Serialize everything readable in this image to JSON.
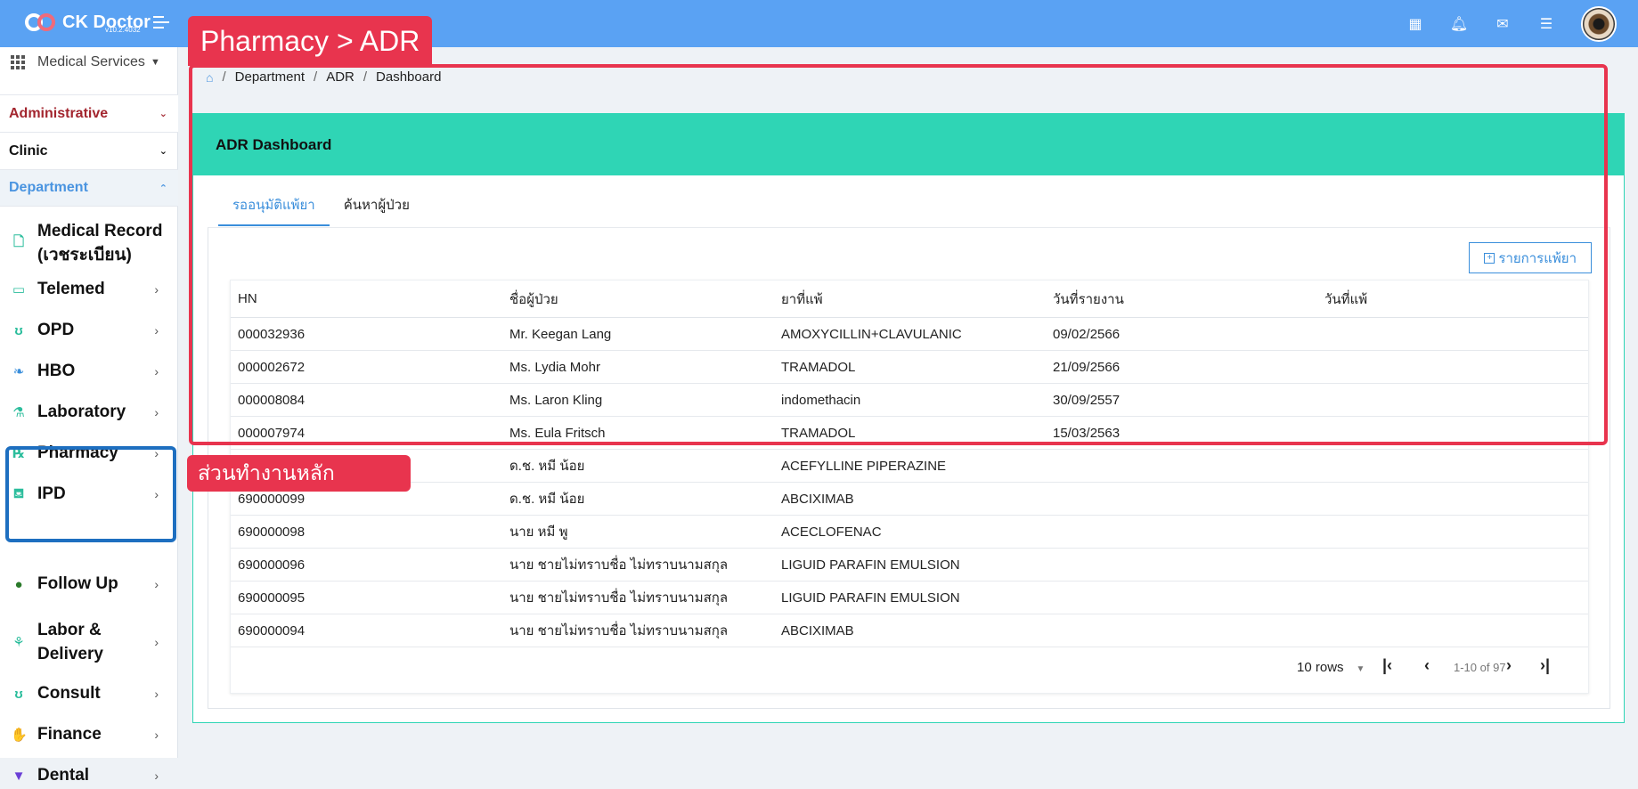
{
  "app": {
    "name": "CK Doctor",
    "version": "v10.2.4032"
  },
  "sidebar": {
    "service_selector": "Medical Services",
    "sections": [
      {
        "label": "Administrative",
        "color": "#a3262f"
      },
      {
        "label": "Clinic",
        "color": "#111111"
      },
      {
        "label": "Department",
        "color": "#4a94e0"
      }
    ],
    "items": [
      {
        "label": "Medical Record",
        "sub": "(เวชระเบียน)",
        "icon": "file-icon"
      },
      {
        "label": "Telemed",
        "icon": "video-icon"
      },
      {
        "label": "OPD",
        "icon": "stethoscope-icon"
      },
      {
        "label": "HBO",
        "icon": "leaf-icon"
      },
      {
        "label": "Laboratory",
        "icon": "microscope-icon"
      },
      {
        "label": "Pharmacy",
        "icon": "rx-icon"
      },
      {
        "label": "IPD",
        "icon": "bed-icon"
      },
      {
        "label": "Follow Up",
        "icon": "person-icon"
      },
      {
        "label": "Labor &",
        "sub": "Delivery",
        "icon": "baby-icon"
      },
      {
        "label": "Consult",
        "icon": "stethoscope-icon"
      },
      {
        "label": "Finance",
        "icon": "hand-coin-icon"
      },
      {
        "label": "Dental",
        "icon": "tooth-icon"
      }
    ]
  },
  "breadcrumb": [
    "Department",
    "ADR",
    "Dashboard"
  ],
  "card": {
    "title": "ADR Dashboard"
  },
  "tabs": [
    "รออนุมัติแพ้ยา",
    "ค้นหาผู้ป่วย"
  ],
  "add_button": "รายการแพ้ยา",
  "table": {
    "headers": [
      "HN",
      "ชื่อผู้ป่วย",
      "ยาที่แพ้",
      "วันที่รายงาน",
      "วันที่แพ้"
    ],
    "rows": [
      [
        "000032936",
        "Mr. Keegan Lang",
        "AMOXYCILLIN+CLAVULANIC",
        "09/02/2566",
        ""
      ],
      [
        "000002672",
        "Ms. Lydia Mohr",
        "TRAMADOL",
        "21/09/2566",
        ""
      ],
      [
        "000008084",
        "Ms. Laron Kling",
        "indomethacin",
        "30/09/2557",
        ""
      ],
      [
        "000007974",
        "Ms. Eula Fritsch",
        "TRAMADOL",
        "15/03/2563",
        ""
      ],
      [
        "",
        "ด.ช. หมี น้อย",
        "ACEFYLLINE PIPERAZINE",
        "",
        ""
      ],
      [
        "690000099",
        "ด.ช. หมี น้อย",
        "ABCIXIMAB",
        "",
        ""
      ],
      [
        "690000098",
        "นาย หมี พู",
        "ACECLOFENAC",
        "",
        ""
      ],
      [
        "690000096",
        "นาย ชายไม่ทราบชื่อ ไม่ทราบนามสกุล",
        "LIGUID PARAFIN EMULSION",
        "",
        ""
      ],
      [
        "690000095",
        "นาย ชายไม่ทราบชื่อ ไม่ทราบนามสกุล",
        "LIGUID PARAFIN EMULSION",
        "",
        ""
      ],
      [
        "690000094",
        "นาย ชายไม่ทราบชื่อ ไม่ทราบนามสกุล",
        "ABCIXIMAB",
        "",
        ""
      ]
    ]
  },
  "pager": {
    "rows_label": "10 rows",
    "range": "1-10 of 97"
  },
  "annotations": {
    "title": "Pharmacy > ADR",
    "main_area": "ส่วนทำงานหลัก"
  },
  "colors": {
    "topbar": "#5aa2f3",
    "card_header": "#2fd5b5",
    "annotation_red": "#e8344e",
    "annotation_blue": "#1e6fc0"
  }
}
